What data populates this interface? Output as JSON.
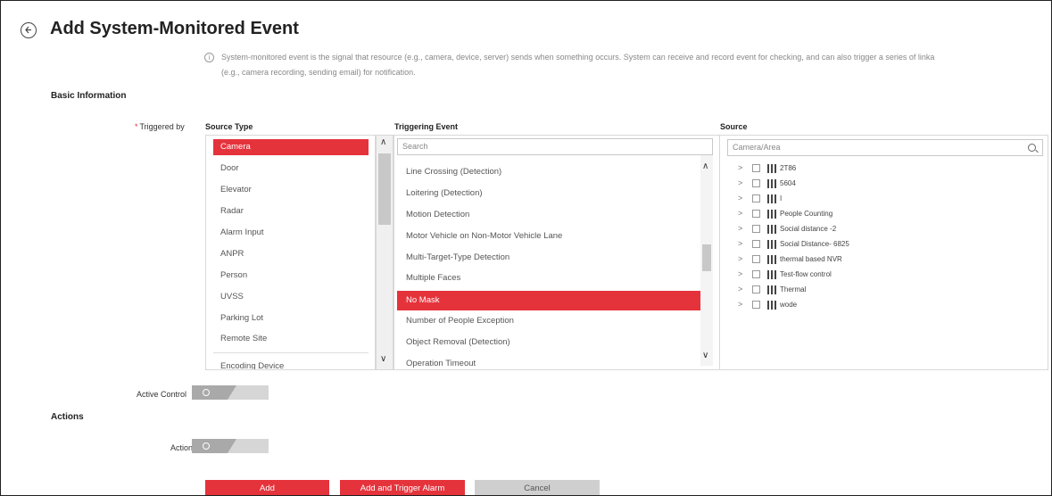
{
  "header": {
    "title": "Add System-Monitored Event",
    "description_line1": "System-monitored event is the signal that resource (e.g., camera, device, server) sends when something occurs. System can receive and record event for checking, and can also trigger a series of linka",
    "description_line2": "(e.g., camera recording, sending email) for notification."
  },
  "basic_info": {
    "section_title": "Basic Information",
    "triggered_by_label": "Triggered by",
    "source_type_header": "Source Type",
    "triggering_event_header": "Triggering Event",
    "source_header": "Source",
    "source_types": [
      "Camera",
      "Door",
      "Elevator",
      "Radar",
      "Alarm Input",
      "ANPR",
      "Person",
      "UVSS",
      "Parking Lot",
      "Remote Site",
      "Encoding Device"
    ],
    "selected_source_type": "Camera",
    "event_search_placeholder": "Search",
    "events": [
      "Line Crossing (Detection)",
      "Loitering (Detection)",
      "Motion Detection",
      "Motor Vehicle on Non-Motor Vehicle Lane",
      "Multi-Target-Type Detection",
      "Multiple Faces",
      "No Mask",
      "Number of People Exception",
      "Object Removal (Detection)",
      "Operation Timeout"
    ],
    "selected_event": "No Mask",
    "source_search_placeholder": "Camera/Area",
    "source_tree": [
      "2T86",
      "5604",
      "I",
      "People Counting",
      "Social distance -2",
      "Social Distance- 6825",
      "thermal based NVR",
      "Test-flow control",
      "Thermal",
      "wode"
    ],
    "active_control_label": "Active Control"
  },
  "actions": {
    "section_title": "Actions",
    "action_label": "Action"
  },
  "buttons": {
    "add": "Add",
    "add_and_trigger": "Add and Trigger Alarm",
    "cancel": "Cancel"
  },
  "colors": {
    "accent": "#e5333c",
    "toggle_off": "#a9a9a9"
  }
}
